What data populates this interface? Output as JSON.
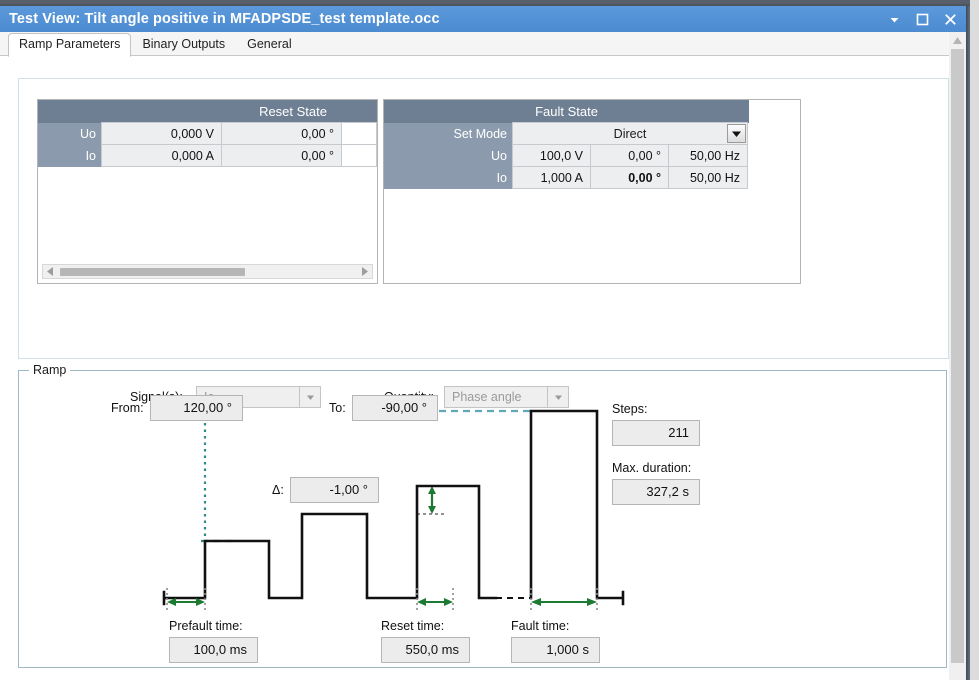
{
  "window": {
    "title": "Test View: Tilt angle positive in MFADPSDE_test template.occ",
    "buttons": {
      "menu": "chevron-down",
      "maximize": "maximize",
      "close": "close"
    }
  },
  "tabs": [
    {
      "label": "Ramp Parameters",
      "active": true
    },
    {
      "label": "Binary Outputs",
      "active": false
    },
    {
      "label": "General",
      "active": false
    }
  ],
  "reset_state": {
    "header": "Reset State",
    "rows": [
      {
        "label": "Uo",
        "magnitude": "0,000 V",
        "angle": "0,00 °"
      },
      {
        "label": "Io",
        "magnitude": "0,000 A",
        "angle": "0,00 °"
      }
    ]
  },
  "fault_state": {
    "header": "Fault State",
    "set_mode_label": "Set Mode",
    "set_mode_value": "Direct",
    "rows": [
      {
        "label": "Uo",
        "magnitude": "100,0 V",
        "angle": "0,00 °",
        "frequency": "50,00 Hz",
        "angle_bold": false
      },
      {
        "label": "Io",
        "magnitude": "1,000 A",
        "angle": "0,00 °",
        "frequency": "50,00 Hz",
        "angle_bold": true
      }
    ]
  },
  "selectors": {
    "signal_label": "Signal(s):",
    "signal_value": "Io",
    "quantity_label": "Quantity:",
    "quantity_value": "Phase angle"
  },
  "ramp": {
    "group_title": "Ramp",
    "from_label": "From:",
    "from_value": "120,00 °",
    "to_label": "To:",
    "to_value": "-90,00 °",
    "delta_label": "Δ:",
    "delta_value": "-1,00 °",
    "steps_label": "Steps:",
    "steps_value": "211",
    "max_duration_label": "Max. duration:",
    "max_duration_value": "327,2 s",
    "prefault_time_label": "Prefault time:",
    "prefault_time_value": "100,0 ms",
    "reset_time_label": "Reset time:",
    "reset_time_value": "550,0 ms",
    "fault_time_label": "Fault time:",
    "fault_time_value": "1,000 s"
  },
  "colors": {
    "title_bar": "#5192d6",
    "table_header": "#6e7f94",
    "table_row_label": "#8b9bad",
    "arrow_green": "#1d7a33",
    "guide_teal": "#2f8a86",
    "panel_border": "#cfe0e8"
  }
}
